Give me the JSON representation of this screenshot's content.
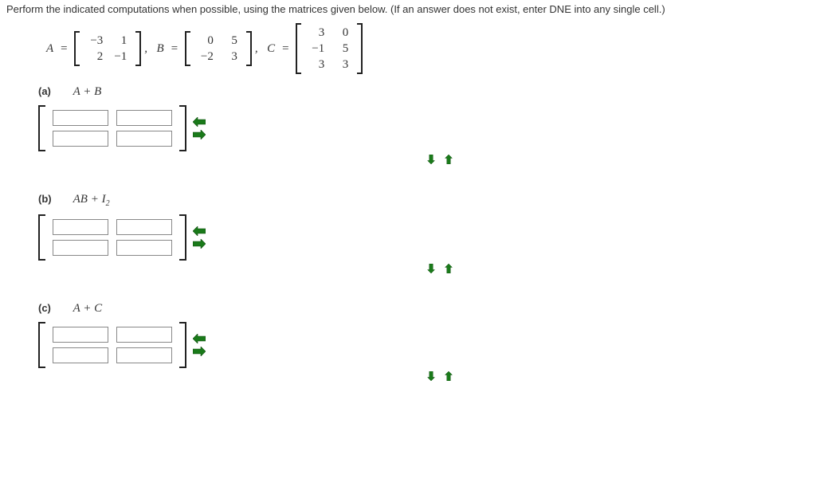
{
  "prompt": "Perform the indicated computations when possible, using the matrices given below. (If an answer does not exist, enter DNE into any single cell.)",
  "matrices": {
    "A": {
      "label": "A",
      "rows": [
        [
          "−3",
          "1"
        ],
        [
          "2",
          "−1"
        ]
      ]
    },
    "B": {
      "label": "B",
      "rows": [
        [
          "0",
          "5"
        ],
        [
          "−2",
          "3"
        ]
      ]
    },
    "C": {
      "label": "C",
      "rows": [
        [
          "3",
          "0"
        ],
        [
          "−1",
          "5"
        ],
        [
          "3",
          "3"
        ]
      ]
    }
  },
  "parts": {
    "a": {
      "tag": "(a)",
      "expr": "A + B"
    },
    "b": {
      "tag": "(b)",
      "expr_html": "AB + I",
      "sub": "2"
    },
    "c": {
      "tag": "(c)",
      "expr": "A + C"
    }
  },
  "inputs": {
    "a": [
      [
        "",
        ""
      ],
      [
        "",
        ""
      ]
    ],
    "b": [
      [
        "",
        ""
      ],
      [
        "",
        ""
      ]
    ],
    "c": [
      [
        "",
        ""
      ],
      [
        "",
        ""
      ]
    ]
  }
}
